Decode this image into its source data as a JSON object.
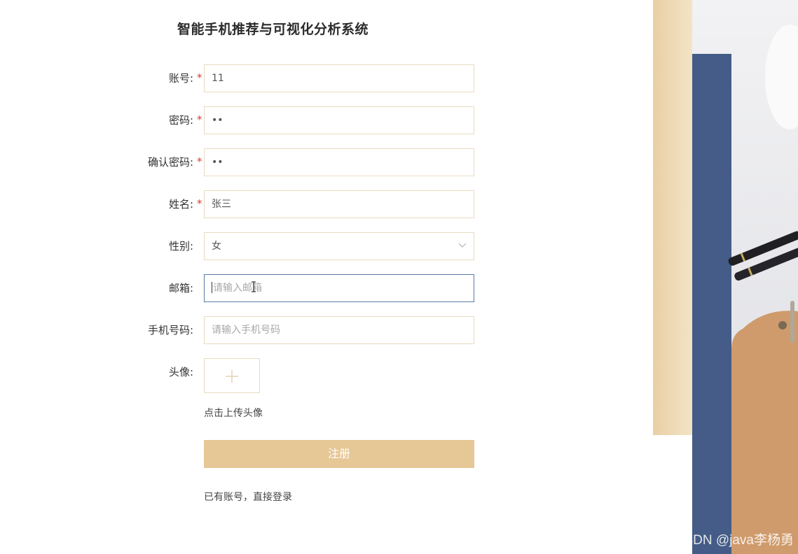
{
  "title": "智能手机推荐与可视化分析系统",
  "form": {
    "account": {
      "label": "账号:",
      "required": true,
      "value": "11"
    },
    "password": {
      "label": "密码:",
      "required": true,
      "value": "••"
    },
    "confirm_password": {
      "label": "确认密码:",
      "required": true,
      "value": "••"
    },
    "name": {
      "label": "姓名:",
      "required": true,
      "value": "张三"
    },
    "gender": {
      "label": "性别:",
      "required": false,
      "value": "女"
    },
    "email": {
      "label": "邮箱:",
      "required": false,
      "value": "",
      "placeholder": "请输入邮箱"
    },
    "phone": {
      "label": "手机号码:",
      "required": false,
      "value": "",
      "placeholder": "请输入手机号码"
    },
    "avatar": {
      "label": "头像:",
      "hint": "点击上传头像"
    },
    "required_mark": "*"
  },
  "buttons": {
    "register": "注册",
    "login_link": "已有账号，直接登录"
  },
  "watermark": "CSDN @java李杨勇",
  "colors": {
    "accent": "#e6c796",
    "field_border": "#e8dcc0",
    "focus_border": "#5b7aa6",
    "required": "#e23a2f"
  }
}
